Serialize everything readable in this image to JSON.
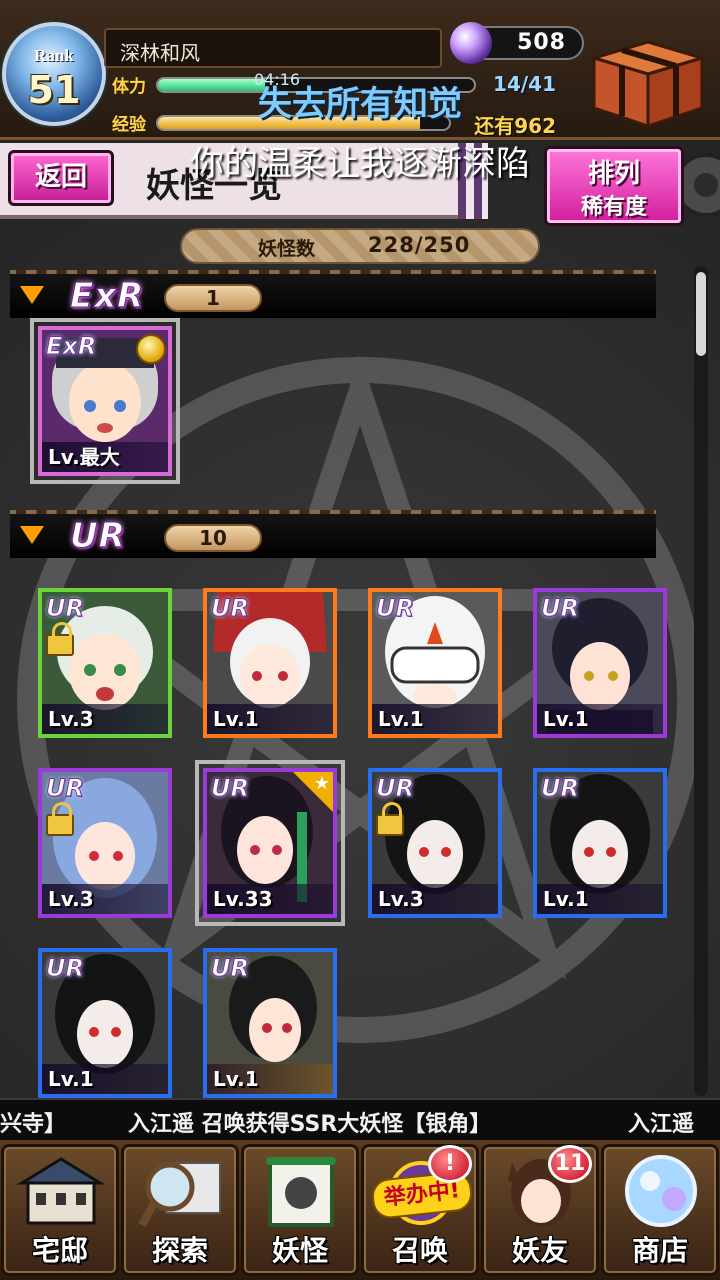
{
  "header": {
    "rank_label": "Rank",
    "rank_value": "51",
    "player_name": "深林和风",
    "stamina_label": "体力",
    "stamina_timer": "04:16",
    "stamina_value": "14/41",
    "stamina_fraction": 0.34,
    "exp_label": "经验",
    "exp_value": "还有962",
    "exp_fraction": 0.9,
    "gems": "508"
  },
  "overlay": {
    "title": "失去所有知觉",
    "subtitle": "你的温柔让我逐渐深陷"
  },
  "title_bar": {
    "back_label": "返回",
    "page_title": "妖怪一览",
    "sort_label_line1": "排列",
    "sort_label_line2": "稀有度"
  },
  "yokai_count": {
    "label": "妖怪数",
    "value": "228/250"
  },
  "sections": [
    {
      "rarity": "ExR",
      "count": "1",
      "cards": [
        {
          "badge": "ExR",
          "level": "Lv.最大",
          "locked": false
        }
      ]
    },
    {
      "rarity": "UR",
      "count": "10",
      "cards": [
        {
          "badge": "UR",
          "level": "Lv.3",
          "locked": true
        },
        {
          "badge": "UR",
          "level": "Lv.1",
          "locked": false
        },
        {
          "badge": "UR",
          "level": "Lv.1",
          "locked": false
        },
        {
          "badge": "UR",
          "level": "Lv.1",
          "locked": false
        },
        {
          "badge": "UR",
          "level": "Lv.3",
          "locked": true
        },
        {
          "badge": "UR",
          "level": "Lv.33",
          "locked": false
        },
        {
          "badge": "UR",
          "level": "Lv.3",
          "locked": true
        },
        {
          "badge": "UR",
          "level": "Lv.1",
          "locked": false
        },
        {
          "badge": "UR",
          "level": "Lv.1",
          "locked": false
        },
        {
          "badge": "UR",
          "level": "Lv.1",
          "locked": false
        }
      ]
    }
  ],
  "ticker": {
    "segment1": "兴寺】",
    "segment2": "入江遥 召唤获得SSR大妖怪【银角】",
    "segment3": "入江遥"
  },
  "nav": {
    "items": [
      {
        "label": "宅邸",
        "icon": "mansion-icon"
      },
      {
        "label": "探索",
        "icon": "magnifier-map-icon"
      },
      {
        "label": "妖怪",
        "icon": "scroll-icon"
      },
      {
        "label": "召唤",
        "icon": "summon-icon",
        "badge": "!",
        "event": "举办中!"
      },
      {
        "label": "妖友",
        "icon": "friend-icon",
        "badge": "11"
      },
      {
        "label": "商店",
        "icon": "crystal-orb-icon"
      }
    ]
  },
  "colors": {
    "accent_pink": "#d11d9e",
    "frame_green": "#6ad43a",
    "frame_orange": "#ff7a1a",
    "frame_purple": "#9a3ad8",
    "frame_blue": "#2a6ef0"
  }
}
